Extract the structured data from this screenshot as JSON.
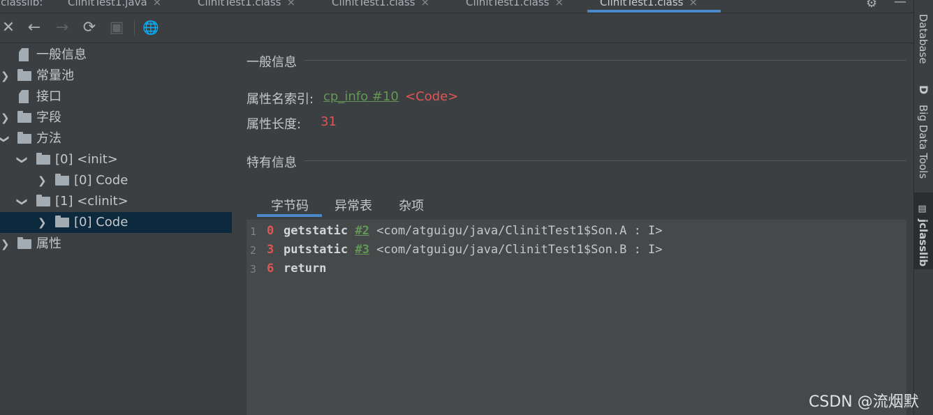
{
  "tabs": [
    {
      "label": "jclasslib:",
      "close": ""
    },
    {
      "label": "ClinitTest1.java",
      "close": "×"
    },
    {
      "label": "ClinitTest1.class",
      "close": "×"
    },
    {
      "label": "ClinitTest1.class",
      "close": "×"
    },
    {
      "label": "ClinitTest1.class",
      "close": "×"
    },
    {
      "label": "ClinitTest1.class",
      "close": "×"
    }
  ],
  "toolbar": {
    "close_glyph": "✕",
    "back_glyph": "←",
    "forward_glyph": "→",
    "refresh_glyph": "⟳",
    "save_glyph": "▣",
    "web_glyph": "🌐"
  },
  "tree": {
    "general": "一般信息",
    "constant_pool": "常量池",
    "interfaces": "接口",
    "fields": "字段",
    "methods": "方法",
    "method_init": "[0] <init>",
    "method_init_code": "[0] Code",
    "method_clinit": "[1] <clinit>",
    "method_clinit_code": "[0] Code",
    "attributes": "属性"
  },
  "main": {
    "general_title": "一般信息",
    "attr_name_index_label": "属性名索引:",
    "attr_name_index_value": "cp_info #10",
    "attr_name_ref": "<Code>",
    "attr_length_label": "属性长度:",
    "attr_length_value": "31",
    "specific_title": "特有信息",
    "subtabs": [
      "字节码",
      "异常表",
      "杂项"
    ]
  },
  "bytecode": [
    {
      "line": "1",
      "offset": "0",
      "op": "getstatic",
      "ref": "#2",
      "comment": "<com/atguigu/java/ClinitTest1$Son.A : I>"
    },
    {
      "line": "2",
      "offset": "3",
      "op": "putstatic",
      "ref": "#3",
      "comment": "<com/atguigu/java/ClinitTest1$Son.B : I>"
    },
    {
      "line": "3",
      "offset": "6",
      "op": "return",
      "ref": "",
      "comment": ""
    }
  ],
  "right_tools": {
    "database": "Database",
    "bigdata_icon": "D",
    "bigdata": "Big Data Tools",
    "jclasslib": "jclasslib"
  },
  "watermark": "CSDN @流烟默",
  "colors": {
    "background": "#3c3f41",
    "accent": "#4a88c7",
    "link_green": "#629755",
    "value_red": "#e05555",
    "selection": "#0d293e"
  }
}
